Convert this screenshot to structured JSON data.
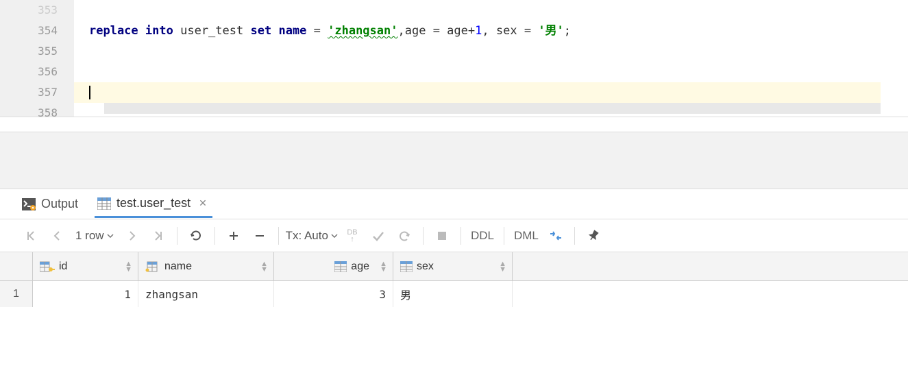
{
  "editor": {
    "lines": [
      "353",
      "354",
      "355",
      "356",
      "357",
      "358"
    ],
    "code": {
      "replace": "replace",
      "into": "into",
      "table": "user_test",
      "set": "set",
      "name_kw": "name",
      "eq": " = ",
      "name_val": "'zhangsan'",
      "comma1": ",",
      "age_kw": "age",
      "age_rhs_kw": "age",
      "plus": "+",
      "one": "1",
      "comma2": ", ",
      "sex_kw": "sex",
      "sex_val": "'男'",
      "semi": ";"
    }
  },
  "tabs": {
    "output_label": "Output",
    "table_label": "test.user_test"
  },
  "toolbar": {
    "row_count": "1 row",
    "tx_label": "Tx: Auto",
    "db_label": "DB",
    "ddl_label": "DDL",
    "dml_label": "DML"
  },
  "grid": {
    "columns": {
      "id": "id",
      "name": "name",
      "age": "age",
      "sex": "sex"
    },
    "rows": [
      {
        "num": "1",
        "id": "1",
        "name": "zhangsan",
        "age": "3",
        "sex": "男"
      }
    ]
  }
}
